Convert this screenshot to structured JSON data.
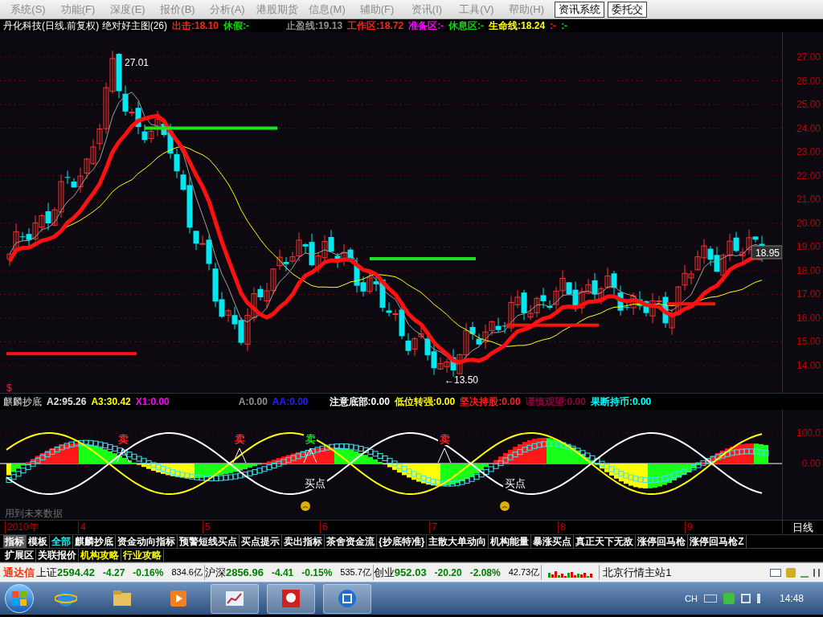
{
  "menu": [
    "系统(S)",
    "功能(F)",
    "深度(E)",
    "报价(B)",
    "分析(A)",
    "港股期货",
    "信息(M)",
    "辅助(F)",
    "资讯(I)",
    "工具(V)",
    "帮助(H)"
  ],
  "menu_buttons": [
    "资讯系统",
    "委托交"
  ],
  "main_chart": {
    "title": "丹化科技(日线.前复权) 绝对好主图(26)",
    "readout_groups": [
      [
        {
          "text": "出击:18.10",
          "color": "#ff2020"
        },
        {
          "text": "休假:-",
          "color": "#00e000"
        }
      ],
      [
        {
          "text": "止盈线:19.13",
          "color": "#909090"
        },
        {
          "text": "工作区:18.72",
          "color": "#ff2020"
        },
        {
          "text": "准备区:-",
          "color": "#ff00ff"
        },
        {
          "text": "休息区:-",
          "color": "#00e000"
        },
        {
          "text": "生命线:18.24",
          "color": "#ffff00"
        },
        {
          "text": ":-",
          "color": "#ff2020"
        },
        {
          "text": ":-",
          "color": "#00e000"
        }
      ]
    ],
    "price_ticks": [
      "27.00",
      "26.00",
      "25.00",
      "24.00",
      "23.00",
      "22.00",
      "21.00",
      "20.00",
      "19.00",
      "18.00",
      "17.00",
      "16.00",
      "15.00",
      "14.00"
    ],
    "high_label": "27.01",
    "low_label": "←13.50",
    "last_price": "18.95",
    "corner_mark": "$"
  },
  "indicator": {
    "title": "麒麟抄底",
    "readout_groups": [
      [
        {
          "text": "A2:95.26",
          "color": "#e0e0e0"
        },
        {
          "text": "A3:30.42",
          "color": "#ffff00"
        },
        {
          "text": "X1:0.00",
          "color": "#ff00ff"
        }
      ],
      [
        {
          "text": "A:0.00",
          "color": "#909090"
        },
        {
          "text": "AA:0.00",
          "color": "#2020ff"
        }
      ],
      [
        {
          "text": "注意底部:0.00",
          "color": "#ffffff"
        },
        {
          "text": "低位转强:0.00",
          "color": "#ffff00"
        },
        {
          "text": "坚决持股:0.00",
          "color": "#ff2020"
        },
        {
          "text": "谨慎观望:0.00",
          "color": "#900040"
        },
        {
          "text": "果断持币:0.00",
          "color": "#00ffff"
        }
      ]
    ],
    "axis_ticks": [
      "100.0",
      "0.00"
    ],
    "sell_marks": [
      {
        "text": "卖",
        "color": "#ff2020"
      },
      {
        "text": "卖",
        "color": "#ff2020"
      },
      {
        "text": "卖",
        "color": "#00e000"
      },
      {
        "text": "卖",
        "color": "#ff2020"
      }
    ],
    "buy_labels": [
      "买点",
      "买点"
    ],
    "note": "用到未来数据"
  },
  "date_axis": {
    "labels": [
      "2010年",
      "4",
      "5",
      "6",
      "7",
      "8",
      "9"
    ],
    "period": "日线"
  },
  "tabs": [
    {
      "label": "指标",
      "selected": true,
      "kind": "plain"
    },
    {
      "label": "模板",
      "selected": false,
      "kind": "plain"
    },
    {
      "label": "全部",
      "selected": false,
      "kind": "filter"
    },
    {
      "label": "麒麟抄底",
      "selected": false,
      "kind": "plain"
    },
    {
      "label": "资金动向指标",
      "selected": false,
      "kind": "plain"
    },
    {
      "label": "预警短线买点",
      "selected": false,
      "kind": "plain"
    },
    {
      "label": "买点提示",
      "selected": false,
      "kind": "plain"
    },
    {
      "label": "卖出指标",
      "selected": false,
      "kind": "plain"
    },
    {
      "label": "茶舍资金流",
      "selected": false,
      "kind": "plain"
    },
    {
      "label": "{抄底特准}",
      "selected": false,
      "kind": "plain"
    },
    {
      "label": "主散大单动向",
      "selected": false,
      "kind": "plain"
    },
    {
      "label": "机构能量",
      "selected": false,
      "kind": "plain"
    },
    {
      "label": "暴涨买点",
      "selected": false,
      "kind": "plain"
    },
    {
      "label": "真正天下无敌",
      "selected": false,
      "kind": "plain"
    },
    {
      "label": "涨停回马枪",
      "selected": false,
      "kind": "plain"
    },
    {
      "label": "涨停回马枪Z",
      "selected": false,
      "kind": "plain"
    }
  ],
  "tabs_row2": [
    {
      "label": "扩展区",
      "kind": "plain"
    },
    {
      "label": "关联报价",
      "kind": "plain"
    },
    {
      "label": "机构攻略",
      "kind": "guide"
    },
    {
      "label": "行业攻略",
      "kind": "guide"
    }
  ],
  "status_bar": {
    "brand": "通达信",
    "indices": [
      {
        "name": "上证",
        "value": "2594.42",
        "change": "-4.27",
        "percent": "-0.16%",
        "amount": "834.6亿"
      },
      {
        "name": "沪深",
        "value": "2856.96",
        "change": "-4.41",
        "percent": "-0.15%",
        "amount": "535.7亿"
      },
      {
        "name": "创业",
        "value": "952.03",
        "change": "-20.20",
        "percent": "-2.08%",
        "amount": "42.73亿"
      }
    ],
    "server": "北京行情主站1"
  },
  "taskbar": {
    "ime": "CH",
    "time": "14:48"
  }
}
